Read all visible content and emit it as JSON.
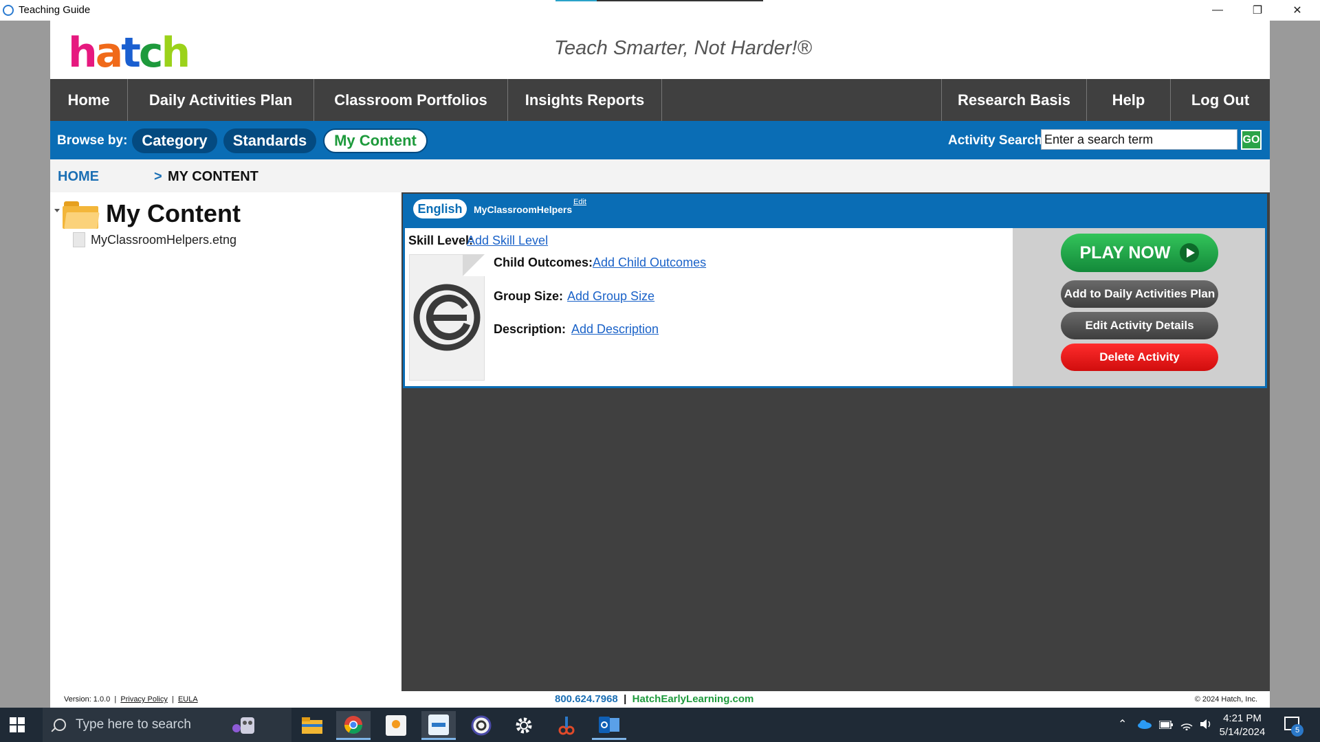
{
  "window": {
    "title": "Teaching Guide",
    "load_progress": 0.2,
    "minimize": "—",
    "restore": "❐",
    "close": "✕"
  },
  "header": {
    "logo_letters": [
      {
        "ch": "h",
        "color": "#e6197f"
      },
      {
        "ch": "a",
        "color": "#f06a1a"
      },
      {
        "ch": "t",
        "color": "#1a5fd0"
      },
      {
        "ch": "c",
        "color": "#1e9a3c"
      },
      {
        "ch": "h",
        "color": "#9bd21a"
      }
    ],
    "tagline": "Teach Smarter, Not Harder!®"
  },
  "nav": {
    "home": "Home",
    "daily": "Daily Activities Plan",
    "portfolios": "Classroom Portfolios",
    "insights": "Insights Reports",
    "research": "Research Basis",
    "help": "Help",
    "logout": "Log Out"
  },
  "browse": {
    "label": "Browse by:",
    "category": "Category",
    "standards": "Standards",
    "my_content": "My Content",
    "search_label": "Activity Search:",
    "search_value": "Enter a search term",
    "go": "GO"
  },
  "breadcrumb": {
    "home": "HOME",
    "sep": ">",
    "current": "MY CONTENT"
  },
  "tree": {
    "title": "My Content",
    "file": "MyClassroomHelpers.etng"
  },
  "card": {
    "language": "English",
    "name": "MyClassroomHelpers",
    "edit": "Edit",
    "skill_label": "Skill Level:",
    "skill_link": "Add Skill Level",
    "outcomes_label": "Child Outcomes:",
    "outcomes_link": "Add Child Outcomes",
    "group_label": "Group Size:",
    "group_link": "Add Group Size",
    "desc_label": "Description:",
    "desc_link": "Add Description",
    "play": "PLAY NOW",
    "add_daily": "Add to Daily Activities Plan",
    "edit_details": "Edit Activity Details",
    "delete": "Delete Activity"
  },
  "footer": {
    "version": "Version: 1.0.0",
    "privacy": "Privacy Policy",
    "eula": "EULA",
    "phone": "800.624.7968",
    "site": "HatchEarlyLearning.com",
    "copyright": "© 2024 Hatch, Inc."
  },
  "taskbar": {
    "search_placeholder": "Type here to search",
    "time": "4:21 PM",
    "date": "5/14/2024",
    "notifications": "5"
  }
}
